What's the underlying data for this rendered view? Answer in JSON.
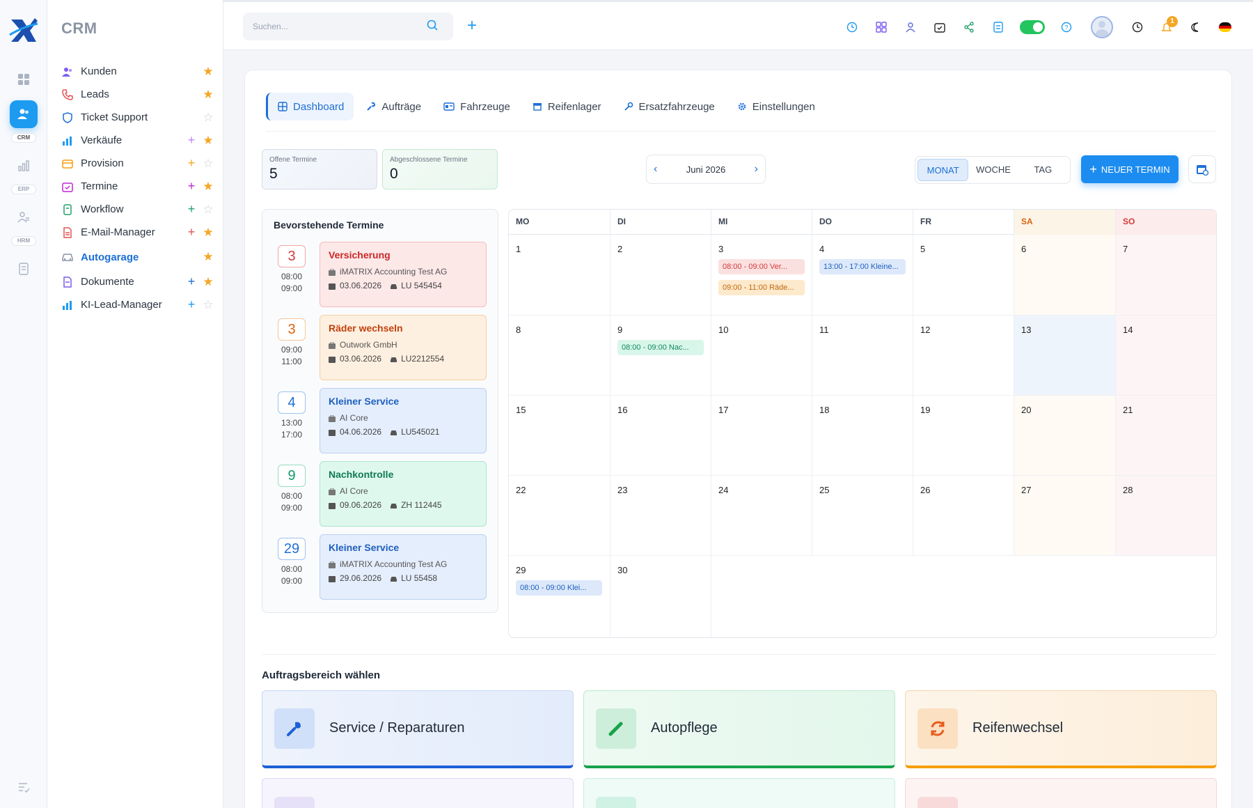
{
  "app": {
    "section_title": "CRM"
  },
  "rail": {
    "labels": [
      "CRM",
      "ERP",
      "HRM"
    ]
  },
  "sidebar": {
    "items": [
      {
        "label": "Kunden",
        "icon": "users-icon",
        "plus": false,
        "starred": true
      },
      {
        "label": "Leads",
        "icon": "phone-icon",
        "plus": false,
        "starred": true
      },
      {
        "label": "Ticket Support",
        "icon": "shield-icon",
        "plus": false,
        "starred": false
      },
      {
        "label": "Verkäufe",
        "icon": "bar-chart-icon",
        "plus": true,
        "starred": true
      },
      {
        "label": "Provision",
        "icon": "wallet-icon",
        "plus": true,
        "starred": false
      },
      {
        "label": "Termine",
        "icon": "calendar-icon",
        "plus": true,
        "starred": true
      },
      {
        "label": "Workflow",
        "icon": "clipboard-icon",
        "plus": true,
        "starred": false
      },
      {
        "label": "E-Mail-Manager",
        "icon": "file-icon",
        "plus": true,
        "starred": true
      },
      {
        "label": "Autogarage",
        "icon": "car-icon",
        "plus": false,
        "starred": true,
        "active": true
      },
      {
        "label": "Dokumente",
        "icon": "document-icon",
        "plus": true,
        "starred": true
      },
      {
        "label": "KI-Lead-Manager",
        "icon": "bar-chart-icon",
        "plus": true,
        "starred": false
      }
    ]
  },
  "topbar": {
    "search_placeholder": "Suchen...",
    "notification_count": "1"
  },
  "tabs": [
    {
      "label": "Dashboard",
      "active": true
    },
    {
      "label": "Aufträge"
    },
    {
      "label": "Fahrzeuge"
    },
    {
      "label": "Reifenlager"
    },
    {
      "label": "Ersatzfahrzeuge"
    },
    {
      "label": "Einstellungen"
    }
  ],
  "stats": {
    "open_label": "Offene Termine",
    "open_value": "5",
    "closed_label": "Abgeschlossene Termine",
    "closed_value": "0"
  },
  "calendar_nav": {
    "month": "Juni 2026"
  },
  "views": {
    "month": "MONAT",
    "week": "WOCHE",
    "day": "TAG"
  },
  "new_button": "NEUER TERMIN",
  "upcoming": {
    "title": "Bevorstehende Termine",
    "items": [
      {
        "day": "3",
        "start": "08:00",
        "end": "09:00",
        "title": "Versicherung",
        "company": "iMATRIX Accounting Test AG",
        "date": "03.06.2026",
        "plate": "LU 545454",
        "color": "red"
      },
      {
        "day": "3",
        "start": "09:00",
        "end": "11:00",
        "title": "Räder wechseln",
        "company": "Outwork GmbH",
        "date": "03.06.2026",
        "plate": "LU2212554",
        "color": "orange"
      },
      {
        "day": "4",
        "start": "13:00",
        "end": "17:00",
        "title": "Kleiner Service",
        "company": "AI Core",
        "date": "04.06.2026",
        "plate": "LU545021",
        "color": "blue"
      },
      {
        "day": "9",
        "start": "08:00",
        "end": "09:00",
        "title": "Nachkontrolle",
        "company": "AI Core",
        "date": "09.06.2026",
        "plate": "ZH 112445",
        "color": "green"
      },
      {
        "day": "29",
        "start": "08:00",
        "end": "09:00",
        "title": "Kleiner Service",
        "company": "iMATRIX Accounting Test AG",
        "date": "29.06.2026",
        "plate": "LU 55458",
        "color": "blue"
      }
    ]
  },
  "calendar": {
    "weekdays": [
      "MO",
      "DI",
      "MI",
      "DO",
      "FR",
      "SA",
      "SO"
    ],
    "days": [
      "1",
      "2",
      "3",
      "4",
      "5",
      "6",
      "7",
      "8",
      "9",
      "10",
      "11",
      "12",
      "13",
      "14",
      "15",
      "16",
      "17",
      "18",
      "19",
      "20",
      "21",
      "22",
      "23",
      "24",
      "25",
      "26",
      "27",
      "28",
      "29",
      "30"
    ],
    "events": {
      "e1": "08:00 - 09:00 Ver...",
      "e2": "09:00 - 11:00 Räde...",
      "e3": "13:00 - 17:00 Kleine...",
      "e4": "08:00 - 09:00 Nac...",
      "e5": "08:00 - 09:00 Klei..."
    }
  },
  "order_area": {
    "title": "Auftragsbereich wählen",
    "cards": [
      {
        "label": "Service / Reparaturen",
        "icon": "wrench-icon"
      },
      {
        "label": "Autopflege",
        "icon": "brush-icon"
      },
      {
        "label": "Reifenwechsel",
        "icon": "refresh-icon"
      }
    ]
  },
  "colors": {
    "primary": "#1d8cf0",
    "accent_blue": "#1d6fd6",
    "star": "#f5a623",
    "toggle": "#22c55e"
  }
}
